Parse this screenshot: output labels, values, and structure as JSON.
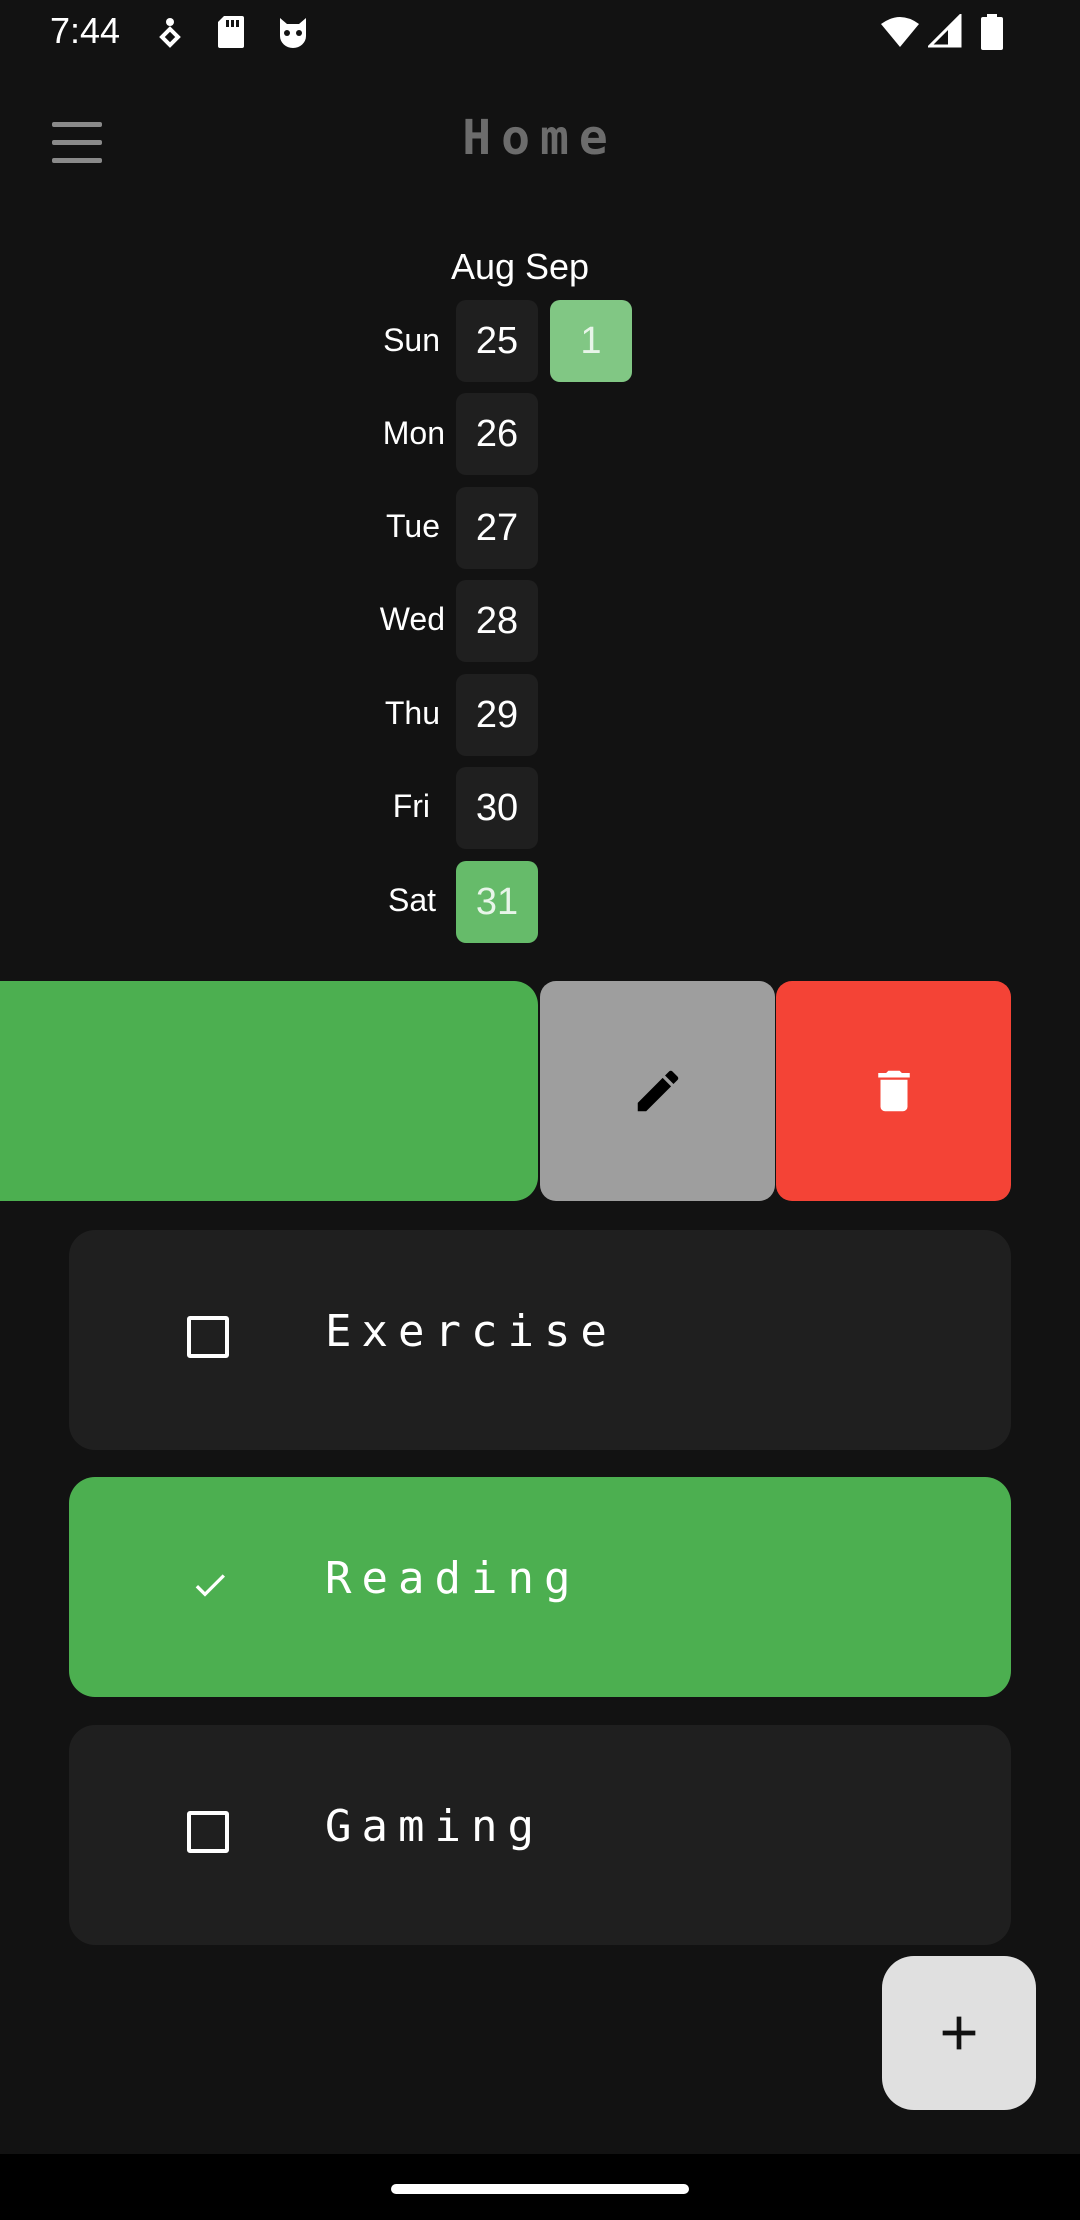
{
  "status_bar": {
    "time": "7:44"
  },
  "app_bar": {
    "title": "Home"
  },
  "calendar": {
    "months": [
      "Aug",
      "Sep"
    ],
    "days": [
      "Sun",
      "Mon",
      "Tue",
      "Wed",
      "Thu",
      "Fri",
      "Sat"
    ],
    "week1": [
      "25",
      "26",
      "27",
      "28",
      "29",
      "30",
      "31"
    ],
    "week2": [
      "1"
    ],
    "completed": [
      "31",
      "1"
    ]
  },
  "habits": [
    {
      "name": "Exercise",
      "checked": false
    },
    {
      "name": "Reading",
      "checked": true
    },
    {
      "name": "Gaming",
      "checked": false
    }
  ],
  "colors": {
    "background": "#121212",
    "card": "#1f1f1f",
    "accent_green": "#4caf50",
    "edit_gray": "#9e9e9e",
    "delete_red": "#f44336",
    "fab": "#e0e0e0"
  },
  "icons": {
    "menu": "menu-icon",
    "edit": "pencil-icon",
    "delete": "trash-icon",
    "add": "plus-icon"
  }
}
